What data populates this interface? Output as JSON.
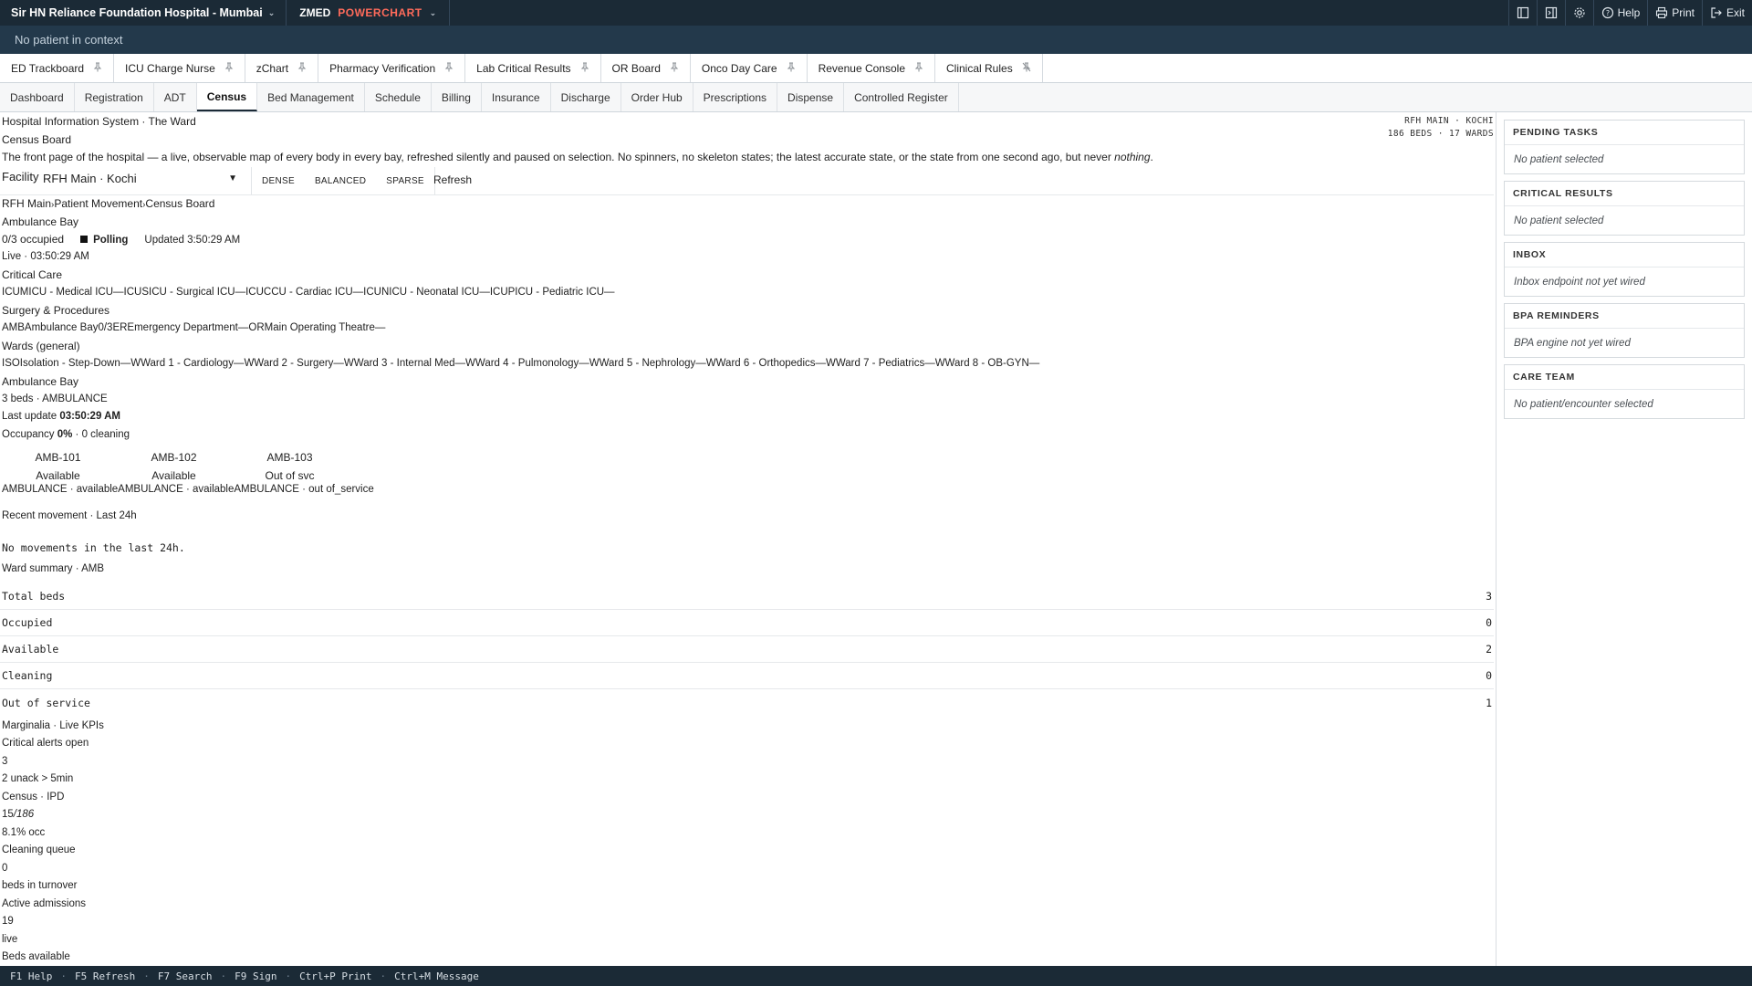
{
  "topbar": {
    "hospital": "Sir HN Reliance Foundation Hospital - Mumbai",
    "app_prefix": "ZMED",
    "app_name": "POWERCHART",
    "help_label": "Help",
    "print_label": "Print",
    "exit_label": "Exit"
  },
  "context": {
    "text": "No patient in context"
  },
  "pinned_tabs": [
    "ED Trackboard",
    "ICU Charge Nurse",
    "zChart",
    "Pharmacy Verification",
    "Lab Critical Results",
    "OR Board",
    "Onco Day Care",
    "Revenue Console",
    "Clinical Rules"
  ],
  "module_tabs": [
    "Dashboard",
    "Registration",
    "ADT",
    "Census",
    "Bed Management",
    "Schedule",
    "Billing",
    "Insurance",
    "Discharge",
    "Order Hub",
    "Prescriptions",
    "Dispense",
    "Controlled Register"
  ],
  "active_module": "Census",
  "header": {
    "system_title": "Hospital Information System · The Ward",
    "page_title": "Census Board",
    "description_main": "The front page of the hospital — a live, observable map of every body in every bay, refreshed silently and paused on selection. No spinners, no skeleton states; the latest accurate state, or the state from one second ago, but never ",
    "description_em": "nothing",
    "description_end": ".",
    "right_line1": "RFH MAIN · KOCHI",
    "right_line2": "186 BEDS · 17 WARDS"
  },
  "facility": {
    "label": "Facility",
    "value": "RFH Main · Kochi"
  },
  "density": {
    "dense": "DENSE",
    "balanced": "BALANCED",
    "sparse": "SPARSE"
  },
  "refresh_label": "Refresh",
  "breadcrumb": {
    "a": "RFH Main",
    "sep1": "›",
    "b": "Patient Movement",
    "sep2": "›",
    "c": "Census Board"
  },
  "current_ward": "Ambulance Bay",
  "status": {
    "occupied": "0/3 occupied",
    "polling": "Polling",
    "updated": "Updated 3:50:29 AM",
    "live": "Live · 03:50:29 AM"
  },
  "groups": {
    "critical_care_title": "Critical Care",
    "critical_care_line": "ICUMICU - Medical ICU—ICUSICU - Surgical ICU—ICUCCU - Cardiac ICU—ICUNICU - Neonatal ICU—ICUPICU - Pediatric ICU—",
    "surgery_title": "Surgery & Procedures",
    "surgery_line": "AMBAmbulance Bay0/3EREmergency Department—ORMain Operating Theatre—",
    "wards_title": "Wards (general)",
    "wards_line": "ISOIsolation - Step-Down—WWard 1 - Cardiology—WWard 2 - Surgery—WWard 3 - Internal Med—WWard 4 - Pulmonology—WWard 5 - Nephrology—WWard 6 - Orthopedics—WWard 7 - Pediatrics—WWard 8 - OB-GYN—"
  },
  "ward_detail": {
    "title": "Ambulance Bay",
    "subtitle": "3 beds · AMBULANCE",
    "last_update_label": "Last update ",
    "last_update_value": "03:50:29 AM",
    "occupancy_label": "Occupancy ",
    "occupancy_value": "0%",
    "occupancy_rest": " · 0 cleaning",
    "beds": [
      {
        "id": "AMB-101",
        "status": "Available"
      },
      {
        "id": "AMB-102",
        "status": "Available"
      },
      {
        "id": "AMB-103",
        "status": "Out of svc"
      }
    ],
    "bed_footer": "AMBULANCE · availableAMBULANCE · availableAMBULANCE · out of_service"
  },
  "movement": {
    "title": "Recent movement · Last 24h",
    "empty": "No movements in the last 24h."
  },
  "summary": {
    "title": "Ward summary · AMB",
    "rows": [
      {
        "label": "Total beds",
        "value": "3"
      },
      {
        "label": "Occupied",
        "value": "0"
      },
      {
        "label": "Available",
        "value": "2"
      },
      {
        "label": "Cleaning",
        "value": "0"
      },
      {
        "label": "Out of service",
        "value": "1"
      }
    ]
  },
  "kpis": {
    "title": "Marginalia · Live KPIs",
    "critical_label": "Critical alerts open",
    "critical_value": "3",
    "critical_sub": "2 unack > 5min",
    "census_label": "Census · IPD",
    "census_value": "15",
    "census_total": "/186",
    "census_sub": "8.1% occ",
    "cleaning_label": "Cleaning queue",
    "cleaning_value": "0",
    "cleaning_sub": "beds in turnover",
    "admissions_label": "Active admissions",
    "admissions_value": "19",
    "admissions_sub": "live",
    "beds_avail_label": "Beds available"
  },
  "rail": [
    {
      "title": "PENDING TASKS",
      "body": "No patient selected"
    },
    {
      "title": "CRITICAL RESULTS",
      "body": "No patient selected"
    },
    {
      "title": "INBOX",
      "body": "Inbox endpoint not yet wired"
    },
    {
      "title": "BPA REMINDERS",
      "body": "BPA engine not yet wired"
    },
    {
      "title": "CARE TEAM",
      "body": "No patient/encounter selected"
    }
  ],
  "footer_keys": [
    "F1 Help",
    "F5 Refresh",
    "F7 Search",
    "F9 Sign",
    "Ctrl+P Print",
    "Ctrl+M Message"
  ]
}
